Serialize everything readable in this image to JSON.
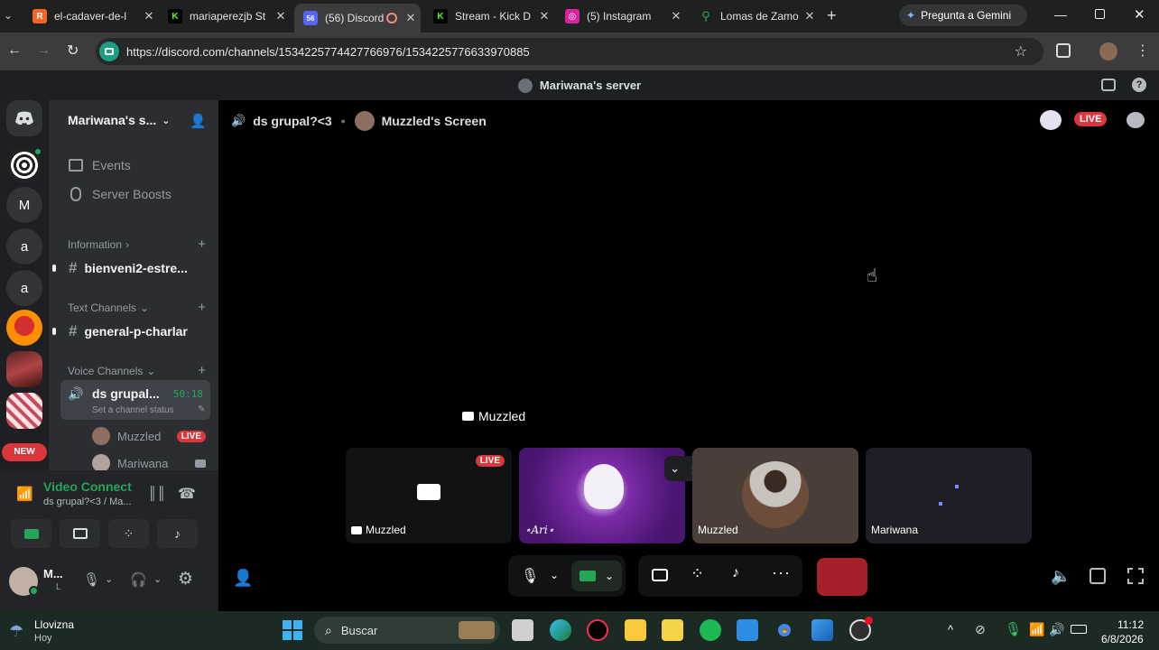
{
  "browser": {
    "tabs": [
      {
        "title": "el-cadaver-de-l",
        "color": "#f26522",
        "glyph": "R"
      },
      {
        "title": "mariaperezjb St",
        "color": "#53fc18",
        "glyph": "K"
      },
      {
        "title": "(56) Discord",
        "color": "#5865f2",
        "glyph": "56"
      },
      {
        "title": "Stream - Kick D",
        "color": "#53fc18",
        "glyph": "K"
      },
      {
        "title": "(5) Instagram",
        "color": "#d6249f",
        "glyph": "◎"
      },
      {
        "title": "Lomas de Zamo",
        "color": "#34a853",
        "glyph": "⚲"
      }
    ],
    "gemini_label": "Pregunta a Gemini",
    "url": "https://discord.com/channels/1534225774427766976/1534225776633970885"
  },
  "discord": {
    "top_title": "Mariwana's server",
    "guilds": [
      "M",
      "a",
      "a"
    ],
    "new_badge": "NEW",
    "server_name": "Mariwana's s...",
    "nav": {
      "events": "Events",
      "boosts": "Server Boosts"
    },
    "categories": {
      "info": "Information",
      "text": "Text Channels",
      "voice": "Voice Channels"
    },
    "channels": {
      "info": "bienveni2-estre...",
      "text": "general-p-charlar",
      "voice": "ds grupal...",
      "voice_time": "50:18",
      "voice_status": "Set a channel status"
    },
    "voice_users": [
      {
        "name": "Muzzled",
        "badge": "LIVE"
      },
      {
        "name": "Mariwana"
      }
    ],
    "voice_panel": {
      "title": "Video Connect",
      "subtitle": "ds grupal?<3 / Ma..."
    },
    "user_panel": {
      "name": "M...",
      "status": "L"
    },
    "stage": {
      "channel": "ds grupal?<3",
      "screen": "Muzzled's Screen",
      "live": "LIVE",
      "focus_label": "Muzzled",
      "tiles": [
        {
          "label": "Muzzled",
          "badge": "LIVE"
        },
        {
          "label": "⋆Ari⋆"
        },
        {
          "label": "Muzzled"
        },
        {
          "label": "Mariwana"
        }
      ]
    }
  },
  "taskbar": {
    "weather_title": "Llovizna",
    "weather_sub": "Hoy",
    "search": "Buscar",
    "time": "11:12",
    "date": "6/8/2026"
  }
}
